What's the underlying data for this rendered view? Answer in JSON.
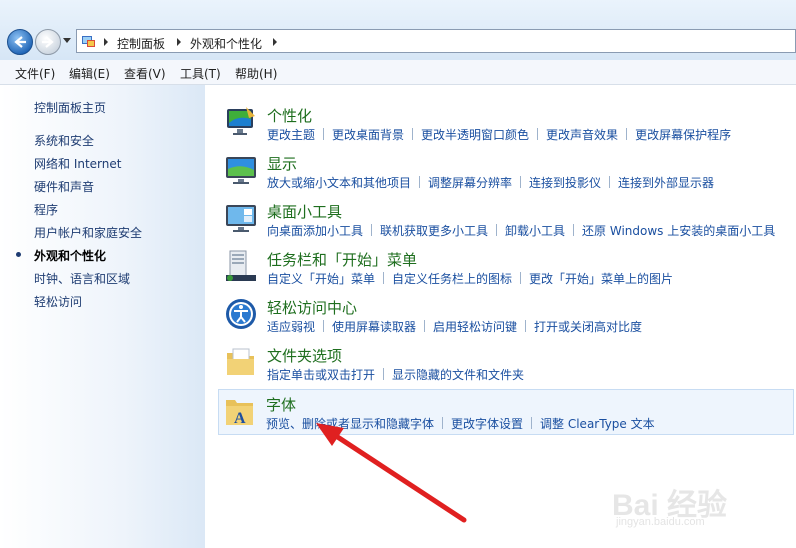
{
  "breadcrumb": [
    "控制面板",
    "外观和个性化"
  ],
  "menu": [
    "文件(F)",
    "编辑(E)",
    "查看(V)",
    "工具(T)",
    "帮助(H)"
  ],
  "sidebar": {
    "home": "控制面板主页",
    "items": [
      {
        "label": "系统和安全",
        "current": false
      },
      {
        "label": "网络和 Internet",
        "current": false
      },
      {
        "label": "硬件和声音",
        "current": false
      },
      {
        "label": "程序",
        "current": false
      },
      {
        "label": "用户帐户和家庭安全",
        "current": false
      },
      {
        "label": "外观和个性化",
        "current": true
      },
      {
        "label": "时钟、语言和区域",
        "current": false
      },
      {
        "label": "轻松访问",
        "current": false
      }
    ]
  },
  "categories": [
    {
      "title": "个性化",
      "icon": "personalization-icon",
      "links": [
        "更改主题",
        "更改桌面背景",
        "更改半透明窗口颜色",
        "更改声音效果",
        "更改屏幕保护程序"
      ]
    },
    {
      "title": "显示",
      "icon": "display-icon",
      "links": [
        "放大或缩小文本和其他项目",
        "调整屏幕分辨率",
        "连接到投影仪",
        "连接到外部显示器"
      ]
    },
    {
      "title": "桌面小工具",
      "icon": "gadgets-icon",
      "links": [
        "向桌面添加小工具",
        "联机获取更多小工具",
        "卸载小工具",
        "还原 Windows 上安装的桌面小工具"
      ]
    },
    {
      "title": "任务栏和「开始」菜单",
      "icon": "taskbar-icon",
      "links": [
        "自定义「开始」菜单",
        "自定义任务栏上的图标",
        "更改「开始」菜单上的图片"
      ]
    },
    {
      "title": "轻松访问中心",
      "icon": "ease-of-access-icon",
      "links": [
        "适应弱视",
        "使用屏幕读取器",
        "启用轻松访问键",
        "打开或关闭高对比度"
      ]
    },
    {
      "title": "文件夹选项",
      "icon": "folder-options-icon",
      "links": [
        "指定单击或双击打开",
        "显示隐藏的文件和文件夹"
      ]
    },
    {
      "title": "字体",
      "icon": "fonts-icon",
      "links": [
        "预览、删除或者显示和隐藏字体",
        "更改字体设置",
        "调整 ClearType 文本"
      ]
    }
  ],
  "watermark": {
    "brand": "Bai  经验",
    "url": "jingyan.baidu.com"
  },
  "colors": {
    "link": "#1a4fa0",
    "title": "#1e6e1e",
    "arrow": "#e02020"
  }
}
